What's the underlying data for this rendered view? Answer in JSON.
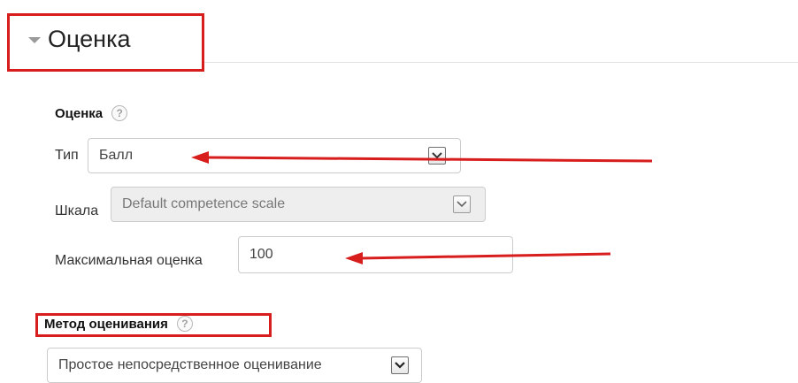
{
  "section": {
    "title": "Оценка",
    "collapse_icon": "triangle-down-icon"
  },
  "grade": {
    "group_label": "Оценка",
    "help_icon": "question-circle-icon",
    "type_label": "Тип",
    "type_value": "Балл",
    "scale_label": "Шкала",
    "scale_value": "Default competence scale",
    "max_grade_label": "Максимальная оценка",
    "max_grade_value": "100"
  },
  "grading_method": {
    "label": "Метод оценивания",
    "help_icon": "question-circle-icon",
    "value": "Простое непосредственное оценивание"
  },
  "annotations": {
    "color": "#d81d1d"
  }
}
